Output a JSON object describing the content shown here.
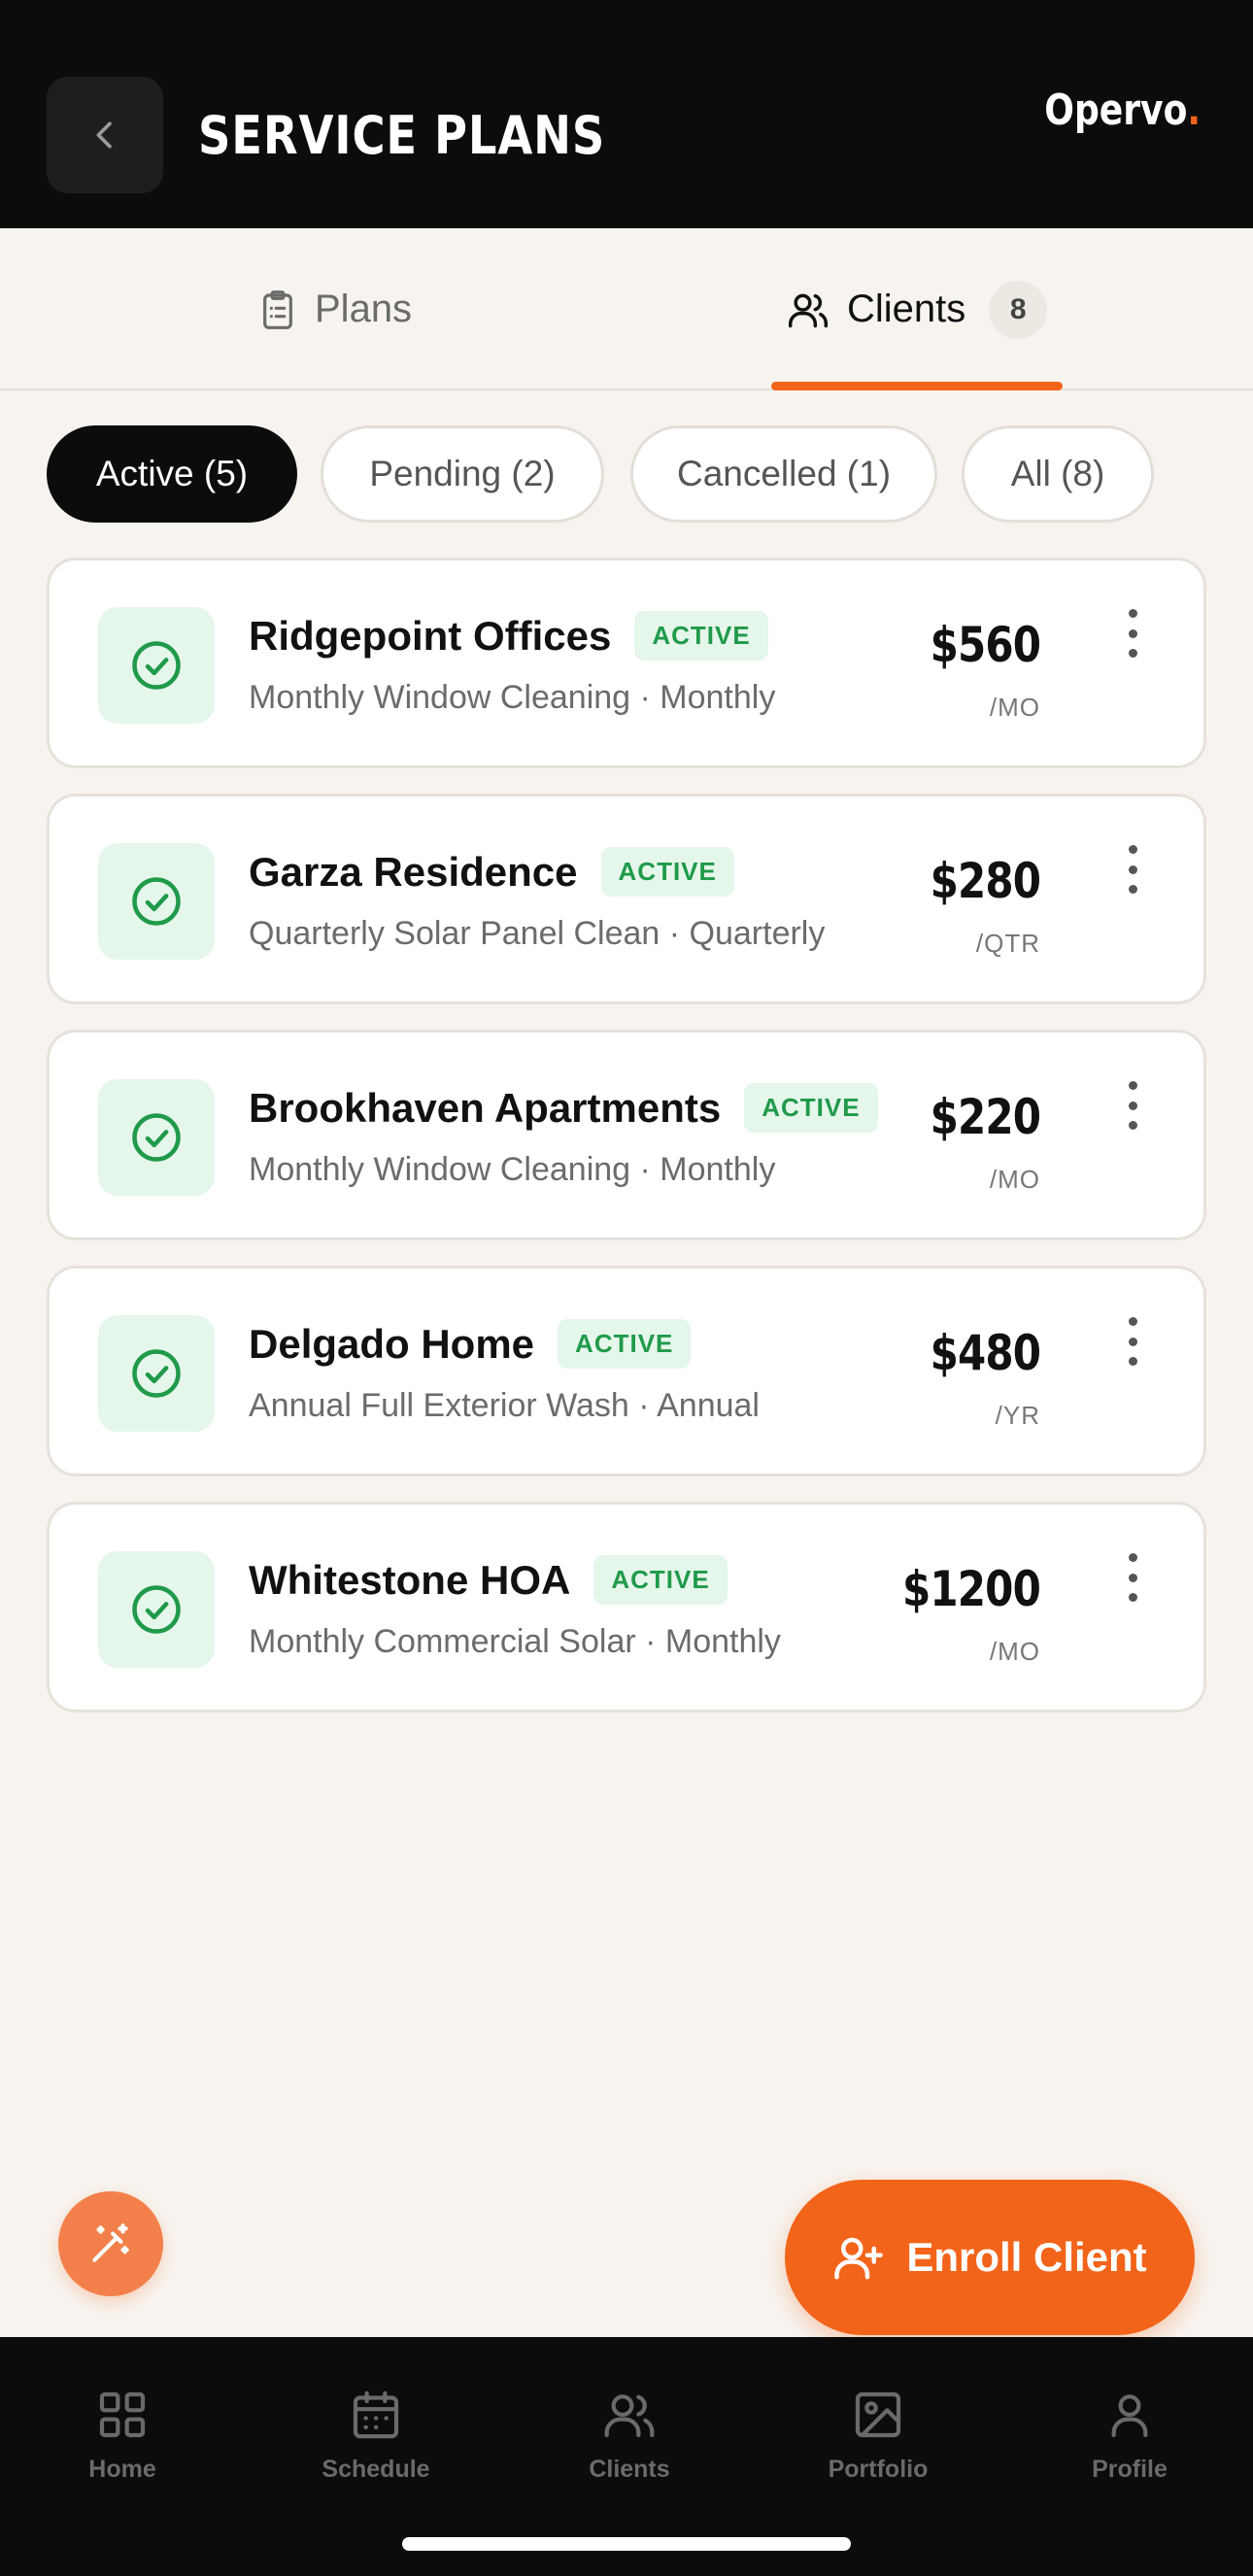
{
  "header": {
    "title": "SERVICE PLANS",
    "brand_name": "Opervo",
    "brand_dot": ".",
    "brand_dot_color": "#f26419",
    "back_icon": "chevron-left-icon"
  },
  "tabs": [
    {
      "label": "Plans",
      "icon": "clipboard-icon",
      "selected": false
    },
    {
      "label": "Clients",
      "icon": "users-icon",
      "badge": "8",
      "selected": true
    }
  ],
  "filters": [
    {
      "label": "Active (5)",
      "selected": true
    },
    {
      "label": "Pending (2)",
      "selected": false
    },
    {
      "label": "Cancelled (1)",
      "selected": false
    },
    {
      "label": "All (8)",
      "selected": false
    }
  ],
  "clients": [
    {
      "name": "Ridgepoint Offices",
      "status": "ACTIVE",
      "plan": "Monthly Window Cleaning · Monthly",
      "price": "$560",
      "period": "/MO"
    },
    {
      "name": "Garza Residence",
      "status": "ACTIVE",
      "plan": "Quarterly Solar Panel Clean · Quarterly",
      "price": "$280",
      "period": "/QTR"
    },
    {
      "name": "Brookhaven Apartments",
      "status": "ACTIVE",
      "plan": "Monthly Window Cleaning · Monthly",
      "price": "$220",
      "period": "/MO"
    },
    {
      "name": "Delgado Home",
      "status": "ACTIVE",
      "plan": "Annual Full Exterior Wash · Annual",
      "price": "$480",
      "period": "/YR"
    },
    {
      "name": "Whitestone HOA",
      "status": "ACTIVE",
      "plan": "Monthly Commercial Solar · Monthly",
      "price": "$1200",
      "period": "/MO"
    }
  ],
  "actions": {
    "enroll_label": "Enroll Client",
    "enroll_icon": "user-plus-icon",
    "magic_icon": "magic-wand-icon"
  },
  "bottom_nav": [
    {
      "label": "Home",
      "icon": "grid-icon"
    },
    {
      "label": "Schedule",
      "icon": "calendar-icon"
    },
    {
      "label": "Clients",
      "icon": "users-icon"
    },
    {
      "label": "Portfolio",
      "icon": "image-icon"
    },
    {
      "label": "Profile",
      "icon": "user-icon"
    }
  ],
  "colors": {
    "accent": "#f26419",
    "header_bg": "#0c0c0c",
    "background": "#f7f4ef",
    "active_green": "#1f9a4a",
    "active_green_bg": "#e5f6ea"
  }
}
